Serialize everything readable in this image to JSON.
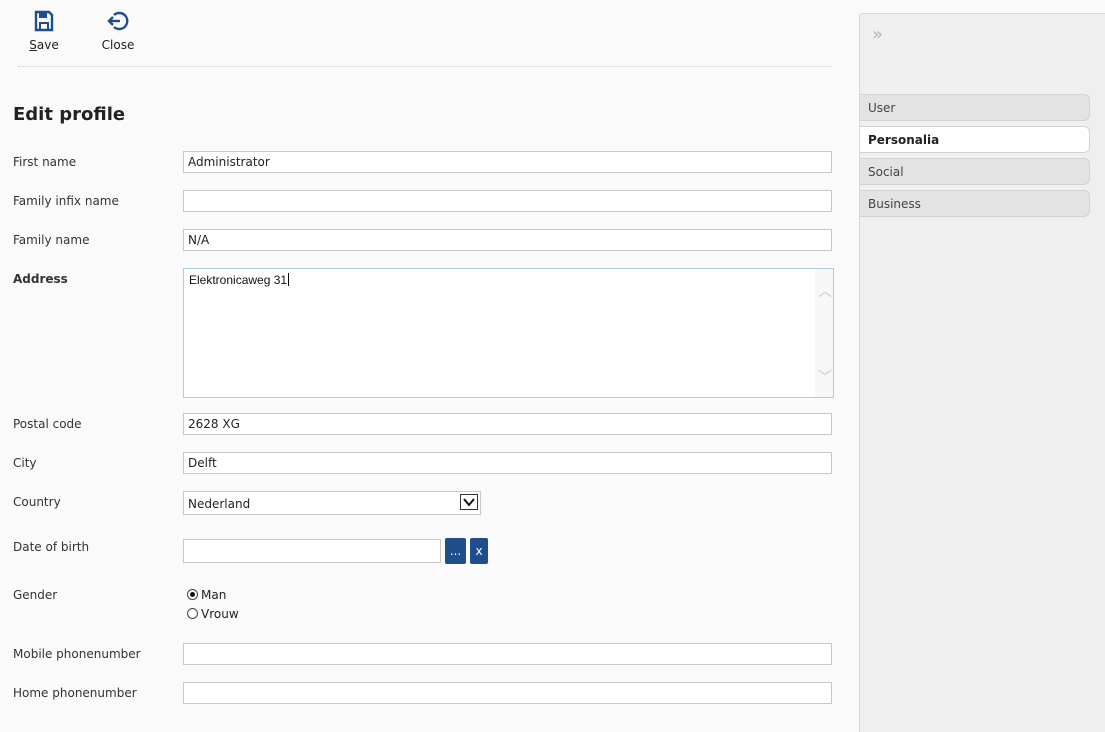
{
  "toolbar": {
    "save": {
      "label": "Save",
      "icon": "floppy-disk-icon"
    },
    "close": {
      "label": "Close",
      "icon": "exit-arrow-icon"
    }
  },
  "form": {
    "title": "Edit profile",
    "first_name": {
      "label": "First name",
      "value": "Administrator"
    },
    "family_infix": {
      "label": "Family infix name",
      "value": ""
    },
    "family_name": {
      "label": "Family name",
      "value": "N/A"
    },
    "address": {
      "label": "Address",
      "value": "Elektronicaweg 31"
    },
    "postal_code": {
      "label": "Postal code",
      "value": "2628 XG"
    },
    "city": {
      "label": "City",
      "value": "Delft"
    },
    "country": {
      "label": "Country",
      "value": "Nederland"
    },
    "date_of_birth": {
      "label": "Date of birth",
      "value": "",
      "picker_label": "...",
      "clear_label": "x"
    },
    "gender": {
      "label": "Gender",
      "options": [
        "Man",
        "Vrouw"
      ],
      "selected": "Man"
    },
    "mobile": {
      "label": "Mobile phonenumber",
      "value": ""
    },
    "home_phone": {
      "label": "Home phonenumber",
      "value": ""
    }
  },
  "sidebar": {
    "collapse_icon": "double-chevron-right-icon",
    "tabs": [
      {
        "label": "User",
        "active": false
      },
      {
        "label": "Personalia",
        "active": true
      },
      {
        "label": "Social",
        "active": false
      },
      {
        "label": "Business",
        "active": false
      }
    ]
  },
  "colors": {
    "accent": "#1f4e8c",
    "background": "#fafafa",
    "sidebar": "#efefef"
  }
}
